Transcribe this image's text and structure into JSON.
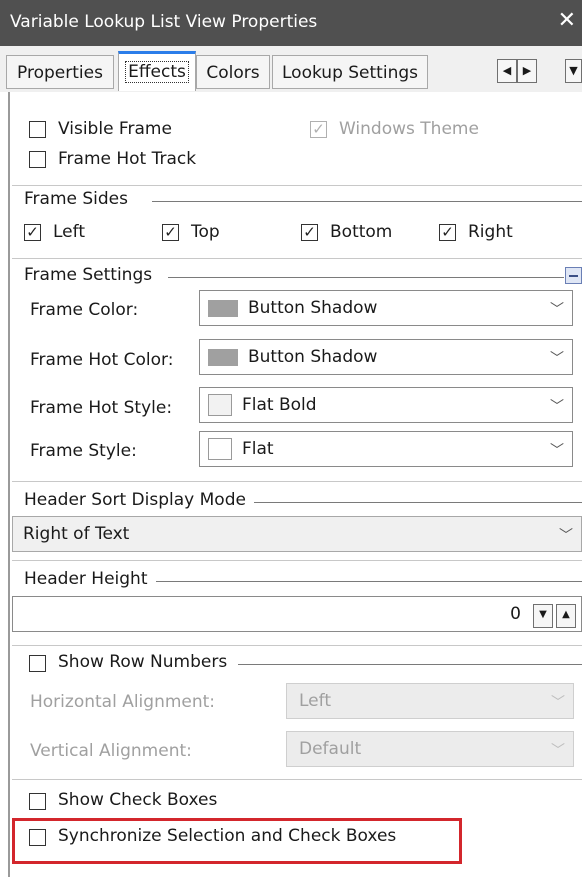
{
  "window": {
    "title": "Variable Lookup List View Properties",
    "close_glyph": "✕"
  },
  "tabs": [
    {
      "label": "Properties",
      "active": false
    },
    {
      "label": "Effects",
      "active": true
    },
    {
      "label": "Colors",
      "active": false
    },
    {
      "label": "Lookup Settings",
      "active": false
    }
  ],
  "scroll_buttons": {
    "left": "◀",
    "right": "▶",
    "down": "▼"
  },
  "effects": {
    "visible_frame": {
      "label": "Visible Frame",
      "checked": false
    },
    "windows_theme": {
      "label": "Windows Theme",
      "checked": true,
      "enabled": false
    },
    "frame_hot_track": {
      "label": "Frame Hot Track",
      "checked": false
    }
  },
  "frame_sides": {
    "title": "Frame Sides",
    "left": {
      "label": "Left",
      "checked": true
    },
    "top": {
      "label": "Top",
      "checked": true
    },
    "bottom": {
      "label": "Bottom",
      "checked": true
    },
    "right": {
      "label": "Right",
      "checked": true
    }
  },
  "frame_settings": {
    "title": "Frame Settings",
    "frame_color": {
      "label": "Frame Color:",
      "value": "Button Shadow",
      "swatch": "#a0a0a0"
    },
    "frame_hot_color": {
      "label": "Frame Hot Color:",
      "value": "Button Shadow",
      "swatch": "#a0a0a0"
    },
    "frame_hot_style": {
      "label": "Frame Hot Style:",
      "value": "Flat Bold",
      "swatch": "#f2f2f2"
    },
    "frame_style": {
      "label": "Frame Style:",
      "value": "Flat",
      "swatch": "#ffffff"
    }
  },
  "header_sort": {
    "title": "Header Sort Display Mode",
    "value": "Right of Text"
  },
  "header_height": {
    "title": "Header Height",
    "value": "0"
  },
  "row_numbers": {
    "label": "Show Row Numbers",
    "checked": false,
    "horizontal_alignment": {
      "label": "Horizontal Alignment:",
      "value": "Left"
    },
    "vertical_alignment": {
      "label": "Vertical Alignment:",
      "value": "Default"
    }
  },
  "check_boxes": {
    "show": {
      "label": "Show Check Boxes",
      "checked": false
    },
    "synchronize": {
      "label": "Synchronize Selection and Check Boxes",
      "checked": false
    }
  },
  "colors": {
    "highlight_box": "#d3262c",
    "tab_accent": "#2b7de9",
    "title_bar": "#505050"
  }
}
